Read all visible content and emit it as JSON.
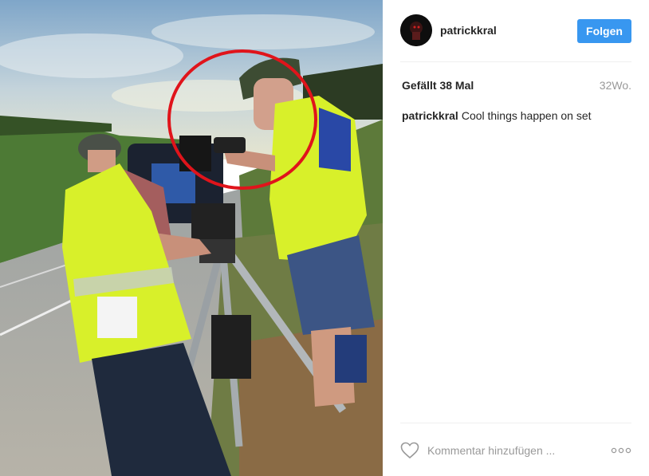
{
  "post": {
    "photo_icon": "post-photo",
    "username": "patrickkral",
    "follow_label": "Folgen",
    "likes_text": "Gefällt 38 Mal",
    "age_text": "32Wo.",
    "caption_user": "patrickkral",
    "caption_text": "Cool things happen on set",
    "comment_placeholder": "Kommentar hinzufügen ...",
    "heart_icon": "heart-icon",
    "more_icon": "more-options-icon"
  },
  "colors": {
    "follow_button": "#3897f0",
    "username": "#262626",
    "muted": "#999999",
    "annotation_circle": "#e0141b",
    "safety_vest": "#d8f02a"
  }
}
